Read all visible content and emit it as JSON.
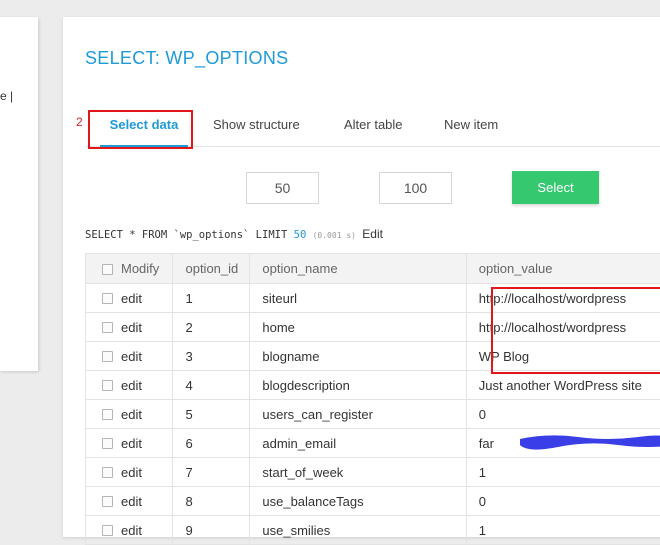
{
  "left_panel": {
    "fragment": "e |"
  },
  "page": {
    "title": "SELECT: WP_OPTIONS",
    "annotation_number": "2"
  },
  "tabs": [
    {
      "label": "Select data",
      "active": true
    },
    {
      "label": "Show structure",
      "active": false
    },
    {
      "label": "Alter table",
      "active": false
    },
    {
      "label": "New item",
      "active": false
    }
  ],
  "controls": {
    "limit_value": "50",
    "length_value": "100",
    "select_label": "Select"
  },
  "sql": {
    "query_prefix": "SELECT * FROM `wp_options` LIMIT",
    "limit": "50",
    "timing": "(0.001 s)",
    "edit_label": "Edit"
  },
  "table": {
    "headers": {
      "modify": "Modify",
      "option_id": "option_id",
      "option_name": "option_name",
      "option_value": "option_value"
    },
    "rows": [
      {
        "edit": "edit",
        "option_id": "1",
        "option_name": "siteurl",
        "option_value": "http://localhost/wordpress"
      },
      {
        "edit": "edit",
        "option_id": "2",
        "option_name": "home",
        "option_value": "http://localhost/wordpress"
      },
      {
        "edit": "edit",
        "option_id": "3",
        "option_name": "blogname",
        "option_value": "WP Blog"
      },
      {
        "edit": "edit",
        "option_id": "4",
        "option_name": "blogdescription",
        "option_value": "Just another WordPress site"
      },
      {
        "edit": "edit",
        "option_id": "5",
        "option_name": "users_can_register",
        "option_value": "0"
      },
      {
        "edit": "edit",
        "option_id": "6",
        "option_name": "admin_email",
        "option_value": "far"
      },
      {
        "edit": "edit",
        "option_id": "7",
        "option_name": "start_of_week",
        "option_value": "1"
      },
      {
        "edit": "edit",
        "option_id": "8",
        "option_name": "use_balanceTags",
        "option_value": "0"
      },
      {
        "edit": "edit",
        "option_id": "9",
        "option_name": "use_smilies",
        "option_value": "1"
      }
    ]
  },
  "colors": {
    "accent": "#1e9ad6",
    "button_green": "#36c86f",
    "highlight_red": "#e0161b",
    "redaction_blue": "#3a3ee6"
  }
}
